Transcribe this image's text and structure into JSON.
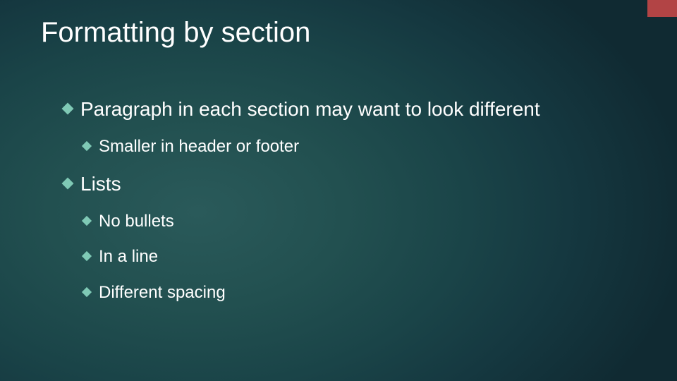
{
  "slide": {
    "title": "Formatting by section",
    "bullets": [
      {
        "text": "Paragraph in each section may want to look different",
        "level": 1,
        "children": [
          {
            "text": "Smaller in header or footer",
            "level": 2
          }
        ]
      },
      {
        "text": "Lists",
        "level": 1,
        "children": [
          {
            "text": "No bullets",
            "level": 2
          },
          {
            "text": "In a line",
            "level": 2
          },
          {
            "text": "Different spacing",
            "level": 2
          }
        ]
      }
    ]
  },
  "colors": {
    "accent": "#b24445",
    "bullet": "#7fc9b5",
    "text": "#ffffff"
  }
}
